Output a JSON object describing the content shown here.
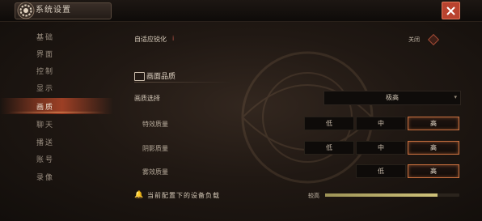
{
  "window": {
    "title": "系统设置"
  },
  "sidebar": {
    "items": [
      {
        "label": "基础",
        "active": false
      },
      {
        "label": "界面",
        "active": false
      },
      {
        "label": "控制",
        "active": false
      },
      {
        "label": "显示",
        "active": false
      },
      {
        "label": "画质",
        "active": true
      },
      {
        "label": "聊天",
        "active": false
      },
      {
        "label": "播送",
        "active": false
      },
      {
        "label": "账号",
        "active": false
      },
      {
        "label": "录像",
        "active": false
      }
    ]
  },
  "adaptive_sharpen": {
    "label": "自适应锐化",
    "info_icon": "i",
    "state": "关闭"
  },
  "section": {
    "title": "画面品质"
  },
  "quality_preset": {
    "label": "画质选择",
    "value": "极高",
    "arrow": "▾"
  },
  "effects_quality": {
    "label": "特效质量",
    "options": [
      "低",
      "中",
      "高"
    ],
    "selected": "高"
  },
  "shadow_quality": {
    "label": "阴影质量",
    "options": [
      "低",
      "中",
      "高"
    ],
    "selected": "高"
  },
  "fog_quality": {
    "label": "雾效质量",
    "options": [
      "低",
      "高"
    ],
    "selected": "高"
  },
  "device_load": {
    "bell_icon": "🔔",
    "label": "当前配置下的设备负载",
    "level": "较高",
    "fill_fraction": 0.84
  },
  "colors": {
    "accent": "#c9703f",
    "close": "#b9432f",
    "active_tab": "#b24628"
  }
}
